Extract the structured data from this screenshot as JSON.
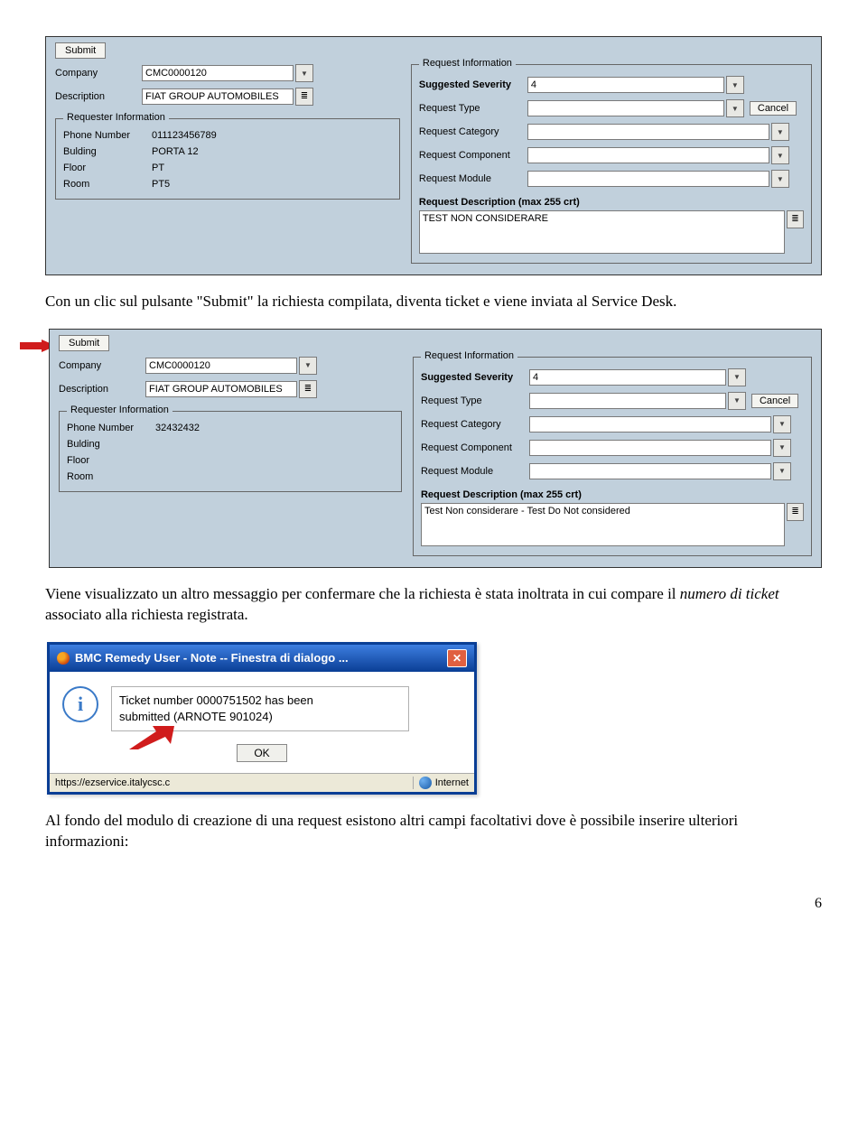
{
  "form1": {
    "submit": "Submit",
    "company_label": "Company",
    "company_value": "CMC0000120",
    "description_label": "Description",
    "description_value": "FIAT GROUP AUTOMOBILES",
    "requester_legend": "Requester Information",
    "phone_label": "Phone Number",
    "phone_value": "011123456789",
    "building_label": "Bulding",
    "building_value": "PORTA 12",
    "floor_label": "Floor",
    "floor_value": "PT",
    "room_label": "Room",
    "room_value": "PT5",
    "reqinfo_legend": "Request Information",
    "severity_label": "Suggested Severity",
    "severity_value": "4",
    "reqtype_label": "Request Type",
    "cancel": "Cancel",
    "reqcat_label": "Request Category",
    "reqcomp_label": "Request Component",
    "reqmod_label": "Request Module",
    "reqdesc_label": "Request Description (max 255 crt)",
    "reqdesc_value": "TEST NON CONSIDERARE"
  },
  "para1": "Con un clic sul pulsante \"Submit\" la richiesta compilata, diventa ticket e viene inviata al Service Desk.",
  "form2": {
    "submit": "Submit",
    "company_label": "Company",
    "company_value": "CMC0000120",
    "description_label": "Description",
    "description_value": "FIAT GROUP AUTOMOBILES",
    "requester_legend": "Requester Information",
    "phone_label": "Phone Number",
    "phone_value": "32432432",
    "building_label": "Bulding",
    "building_value": "",
    "floor_label": "Floor",
    "floor_value": "",
    "room_label": "Room",
    "room_value": "",
    "reqinfo_legend": "Request Information",
    "severity_label": "Suggested Severity",
    "severity_value": "4",
    "reqtype_label": "Request Type",
    "cancel": "Cancel",
    "reqcat_label": "Request Category",
    "reqcomp_label": "Request Component",
    "reqmod_label": "Request Module",
    "reqdesc_label": "Request Description (max 255 crt)",
    "reqdesc_value": "Test Non considerare - Test Do Not considered"
  },
  "para2_pre": "Viene visualizzato un altro messaggio per confermare che la richiesta è stata inoltrata in cui compare il ",
  "para2_italic": "numero di ticket",
  "para2_post": " associato alla richiesta registrata.",
  "dialog": {
    "title": "BMC Remedy User - Note -- Finestra di dialogo ...",
    "message_line1": "Ticket number 0000751502 has been",
    "message_line2": "submitted (ARNOTE 901024)",
    "ok": "OK",
    "status_url": "https://ezservice.italycsc.c",
    "status_zone": "Internet"
  },
  "para3": "Al fondo del modulo di creazione di una request esistono altri campi facoltativi dove è possibile inserire ulteriori informazioni:",
  "page_number": "6"
}
